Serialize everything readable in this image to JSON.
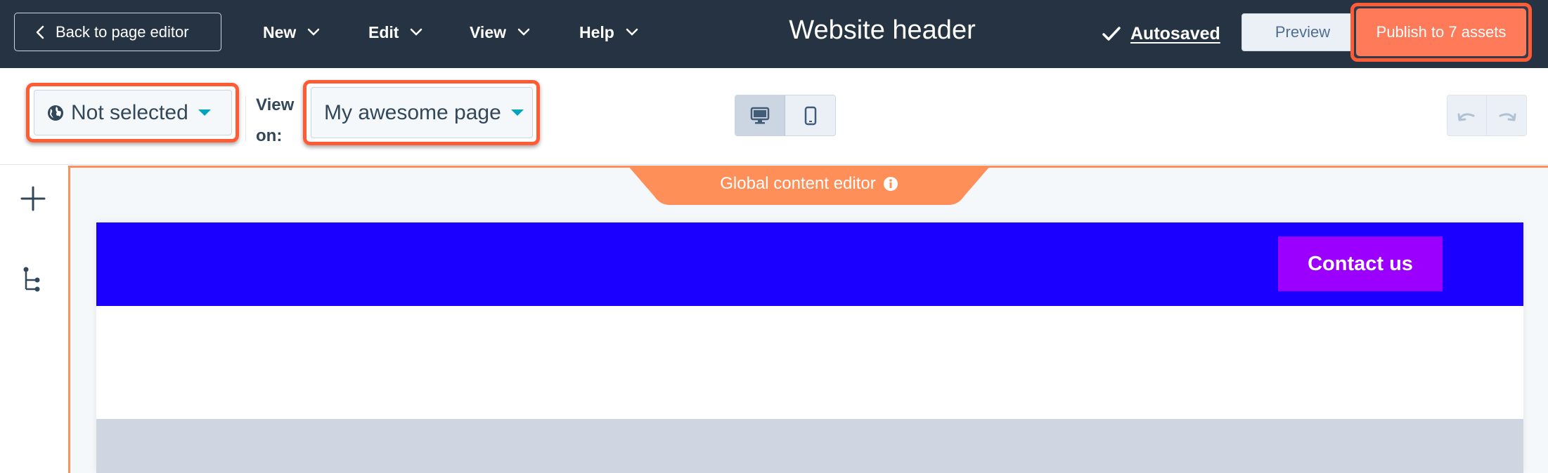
{
  "topbar": {
    "back_label": "Back to page editor",
    "menus": [
      "New",
      "Edit",
      "View",
      "Help"
    ],
    "title": "Website header",
    "autosave_label": "Autosaved",
    "preview_label": "Preview",
    "publish_label": "Publish to 7 assets"
  },
  "toolbar": {
    "language_value": "Not selected",
    "view_on_label": "View on:",
    "page_value": "My awesome page",
    "device_options": [
      "desktop-icon",
      "mobile-icon"
    ],
    "active_device": "desktop"
  },
  "left_rail": {
    "icons": [
      "add-icon",
      "tree-icon"
    ]
  },
  "canvas": {
    "tab_label": "Global content editor",
    "contact_label": "Contact us"
  },
  "colors": {
    "topbar_bg": "#253342",
    "accent_orange": "#ff7a59",
    "highlight_border": "#ff5c35",
    "tab_orange": "#ff8f59",
    "header_blue": "#1b00ff",
    "button_purple": "#9b00ff",
    "caret_teal": "#00a4bd"
  }
}
